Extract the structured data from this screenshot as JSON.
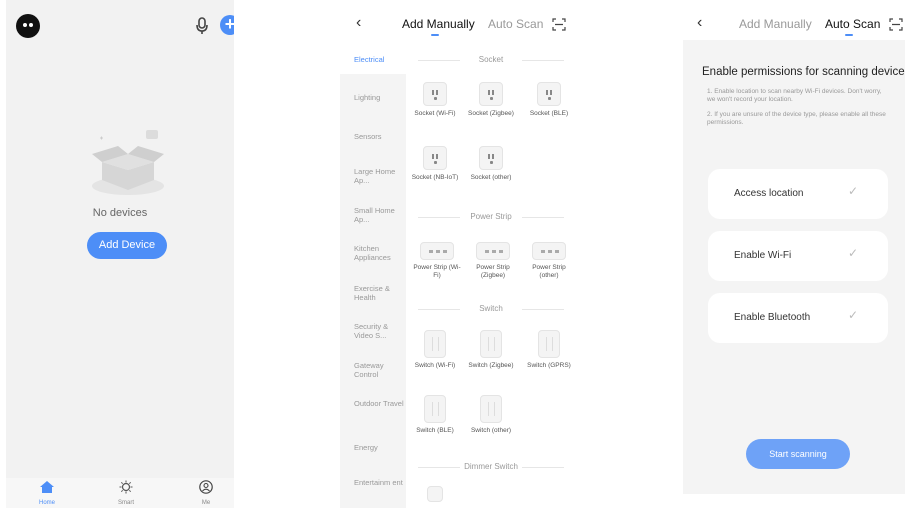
{
  "colors": {
    "accent": "#4d8ef7",
    "background_gray": "#f2f2f2",
    "scan_button": "#6ea2f7"
  },
  "home": {
    "empty_text": "No devices",
    "add_button": "Add Device",
    "tabs": [
      {
        "label": "Home",
        "icon": "home-icon",
        "active": true
      },
      {
        "label": "Smart",
        "icon": "sun-icon",
        "active": false
      },
      {
        "label": "Me",
        "icon": "user-icon",
        "active": false
      }
    ]
  },
  "manual": {
    "tab_manual": "Add Manually",
    "tab_scan": "Auto Scan",
    "categories": [
      {
        "label": "Electrical",
        "active": true
      },
      {
        "label": "Lighting"
      },
      {
        "label": "Sensors"
      },
      {
        "label": "Large Home Ap..."
      },
      {
        "label": "Small Home Ap..."
      },
      {
        "label": "Kitchen Appliances"
      },
      {
        "label": "Exercise & Health"
      },
      {
        "label": "Security & Video S..."
      },
      {
        "label": "Gateway Control"
      },
      {
        "label": "Outdoor Travel"
      },
      {
        "label": "Energy"
      },
      {
        "label": "Entertainm ent"
      }
    ],
    "sections": {
      "socket": "Socket",
      "strip": "Power Strip",
      "switch": "Switch",
      "dimmer": "Dimmer Switch"
    },
    "sockets": [
      "Socket (Wi-Fi)",
      "Socket (Zigbee)",
      "Socket (BLE)",
      "Socket (NB-IoT)",
      "Socket (other)"
    ],
    "strips": [
      "Power Strip (Wi-Fi)",
      "Power Strip (Zigbee)",
      "Power Strip (other)"
    ],
    "switches": [
      "Switch (Wi-Fi)",
      "Switch (Zigbee)",
      "Switch (GPRS)",
      "Switch (BLE)",
      "Switch (other)"
    ]
  },
  "scan": {
    "tab_manual": "Add Manually",
    "tab_scan": "Auto Scan",
    "title": "Enable permissions for scanning devices",
    "desc1": "1. Enable location to scan nearby Wi-Fi devices. Don't worry, we won't record your location.",
    "desc2": "2. If you are unsure of the device type, please enable all these permissions.",
    "permissions": [
      {
        "label": "Access location"
      },
      {
        "label": "Enable Wi-Fi"
      },
      {
        "label": "Enable Bluetooth"
      }
    ],
    "check_glyph": "✓",
    "start_button": "Start scanning"
  }
}
